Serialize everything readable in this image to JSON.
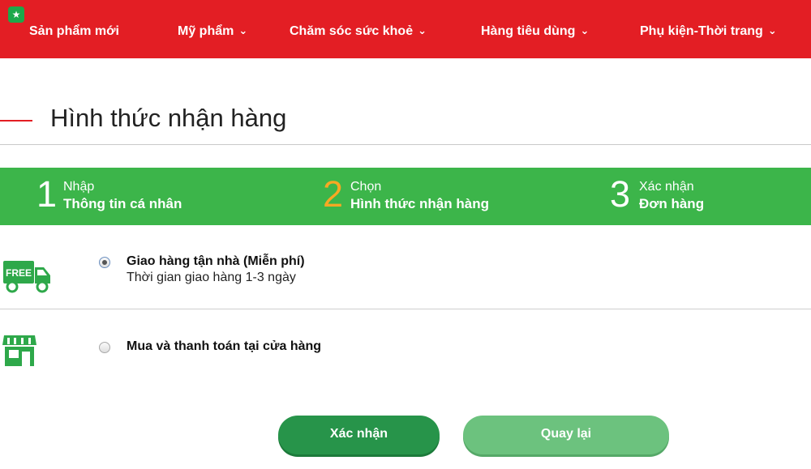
{
  "nav": {
    "items": [
      {
        "label": "Sản phẩm mới",
        "chevron": false
      },
      {
        "label": "Mỹ phẩm",
        "chevron": true
      },
      {
        "label": "Chăm sóc sức khoẻ",
        "chevron": true
      },
      {
        "label": "Hàng tiêu dùng",
        "chevron": true
      },
      {
        "label": "Phụ kiện-Thời trang",
        "chevron": true
      }
    ],
    "chevron_glyph": "⌄",
    "badge_glyph": "★",
    "background": "#e31e24"
  },
  "page": {
    "title": "Hình thức nhận hàng"
  },
  "steps": [
    {
      "number": "1",
      "top": "Nhập",
      "bottom": "Thông tin cá nhân",
      "active": false
    },
    {
      "number": "2",
      "top": "Chọn",
      "bottom": "Hình thức nhận hàng",
      "active": true
    },
    {
      "number": "3",
      "top": "Xác nhận",
      "bottom": "Đơn hàng",
      "active": false
    }
  ],
  "options": [
    {
      "title": "Giao hàng tận nhà (Miễn phí)",
      "subtitle": "Thời gian giao hàng 1-3 ngày",
      "selected": true,
      "icon": "free-delivery-truck-icon",
      "icon_text": "FREE"
    },
    {
      "title": "Mua và thanh toán tại cửa hàng",
      "subtitle": "",
      "selected": false,
      "icon": "store-icon"
    }
  ],
  "buttons": {
    "confirm": "Xác nhận",
    "back": "Quay lại"
  },
  "colors": {
    "brand_red": "#e31e24",
    "steps_green": "#3cb54a",
    "active_step_orange": "#f7a823",
    "confirm_green": "#27944a",
    "back_green": "#6cc27e"
  }
}
